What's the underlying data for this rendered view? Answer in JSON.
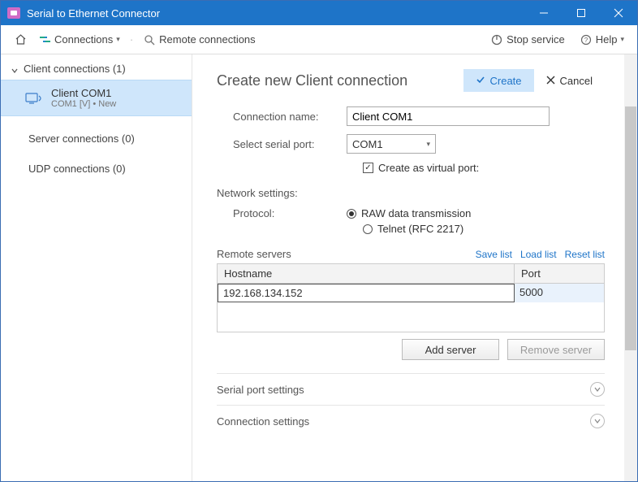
{
  "window": {
    "title": "Serial to Ethernet Connector"
  },
  "toolbar": {
    "connections_label": "Connections",
    "remote_label": "Remote connections",
    "stop_service_label": "Stop service",
    "help_label": "Help"
  },
  "sidebar": {
    "client_header": "Client connections (1)",
    "server_header": "Server connections (0)",
    "udp_header": "UDP connections (0)",
    "item": {
      "title": "Client COM1",
      "subtitle": "COM1 [V] • New"
    }
  },
  "main": {
    "title": "Create new Client connection",
    "create_btn": "Create",
    "cancel_btn": "Cancel",
    "conn_name_label": "Connection name:",
    "conn_name_value": "Client COM1",
    "select_port_label": "Select serial port:",
    "select_port_value": "COM1",
    "create_virtual_label": "Create as virtual port:",
    "network_settings_title": "Network settings:",
    "protocol_label": "Protocol:",
    "protocol_raw": "RAW data transmission",
    "protocol_telnet": "Telnet (RFC 2217)",
    "remote_servers_label": "Remote servers",
    "save_list": "Save list",
    "load_list": "Load list",
    "reset_list": "Reset list",
    "grid": {
      "hostname_header": "Hostname",
      "port_header": "Port",
      "rows": [
        {
          "hostname": "192.168.134.152",
          "port": "5000"
        }
      ]
    },
    "add_server_btn": "Add server",
    "remove_server_btn": "Remove server",
    "serial_port_settings": "Serial port settings",
    "connection_settings": "Connection settings"
  }
}
